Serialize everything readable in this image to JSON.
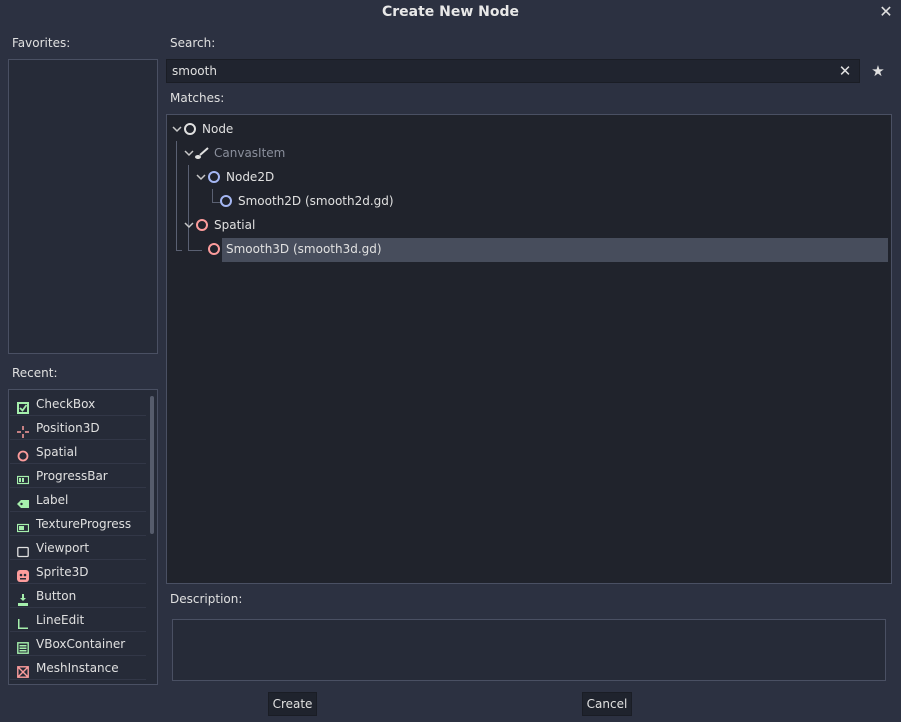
{
  "dialog": {
    "title": "Create New Node",
    "close_glyph": "✕"
  },
  "favorites": {
    "label": "Favorites:"
  },
  "search": {
    "label": "Search:",
    "value": "smooth",
    "clear_glyph": "✕",
    "favorite_glyph": "★"
  },
  "matches": {
    "label": "Matches:",
    "nodes": [
      {
        "label": "Node",
        "icon": "circle-icon",
        "color": "#e0e0e0"
      },
      {
        "label": "CanvasItem",
        "icon": "brush-icon",
        "color": "#8a8f9c"
      },
      {
        "label": "Node2D",
        "icon": "circle-icon",
        "color": "#a5b7f3"
      },
      {
        "label": "Smooth2D (smooth2d.gd)",
        "icon": "circle-icon",
        "color": "#a5b7f3"
      },
      {
        "label": "Spatial",
        "icon": "circle-icon",
        "color": "#fc9c9c"
      },
      {
        "label": "Smooth3D (smooth3d.gd)",
        "icon": "circle-icon",
        "color": "#fc9c9c",
        "selected": true
      }
    ]
  },
  "recent": {
    "label": "Recent:",
    "items": [
      {
        "label": "CheckBox",
        "icon": "checkbox-icon",
        "color": "#a5efac"
      },
      {
        "label": "Position3D",
        "icon": "position3d-icon",
        "color": "#fc9c9c"
      },
      {
        "label": "Spatial",
        "icon": "circle-icon",
        "color": "#fc9c9c"
      },
      {
        "label": "ProgressBar",
        "icon": "progressbar-icon",
        "color": "#a5efac"
      },
      {
        "label": "Label",
        "icon": "label-icon",
        "color": "#a5efac"
      },
      {
        "label": "TextureProgress",
        "icon": "textureprogress-icon",
        "color": "#a5efac"
      },
      {
        "label": "Viewport",
        "icon": "viewport-icon",
        "color": "#e0e0e0"
      },
      {
        "label": "Sprite3D",
        "icon": "sprite3d-icon",
        "color": "#fc9c9c"
      },
      {
        "label": "Button",
        "icon": "button-icon",
        "color": "#a5efac"
      },
      {
        "label": "LineEdit",
        "icon": "lineedit-icon",
        "color": "#a5efac"
      },
      {
        "label": "VBoxContainer",
        "icon": "vboxcontainer-icon",
        "color": "#a5efac"
      },
      {
        "label": "MeshInstance",
        "icon": "meshinstance-icon",
        "color": "#fc9c9c"
      }
    ]
  },
  "description": {
    "label": "Description:"
  },
  "buttons": {
    "create": "Create",
    "cancel": "Cancel"
  }
}
